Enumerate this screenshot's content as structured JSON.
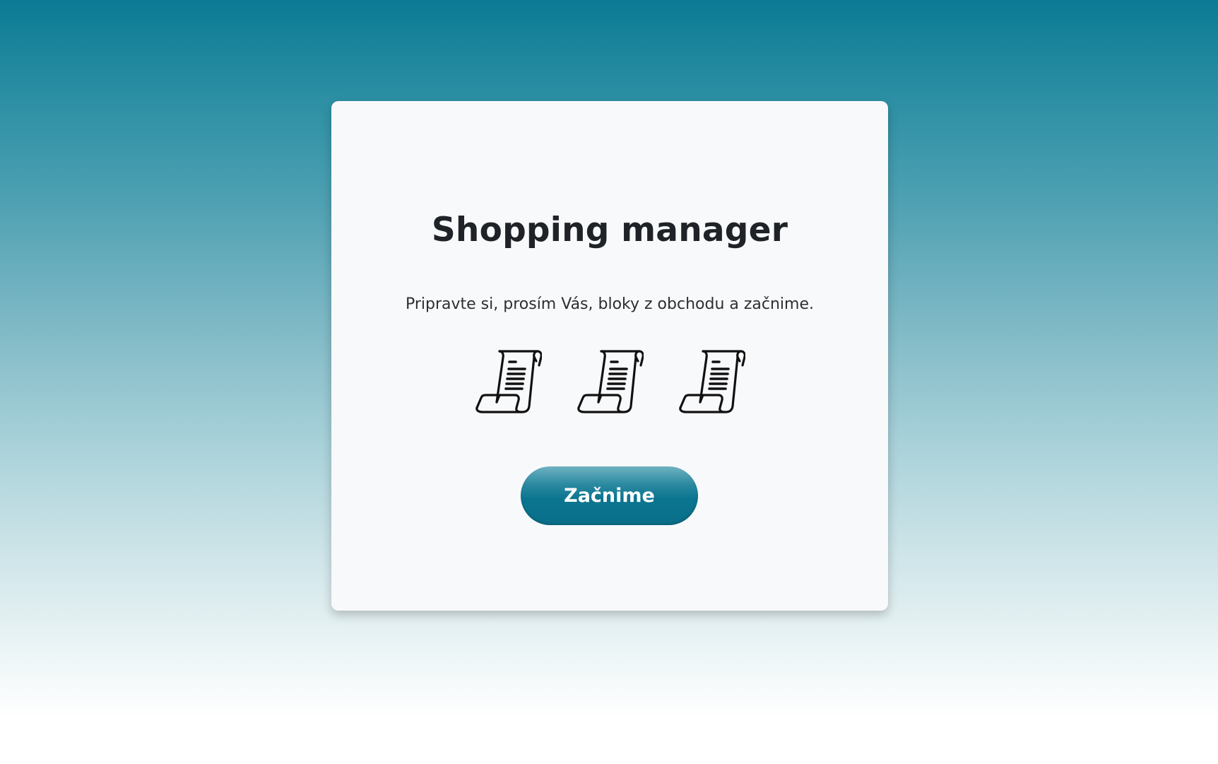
{
  "app": {
    "title": "Shopping manager",
    "subtitle": "Pripravte si, prosím Vás, bloky z obchodu a začnime.",
    "icons": [
      "receipt-scroll-icon",
      "receipt-scroll-icon",
      "receipt-scroll-icon"
    ],
    "start_button_label": "Začnime"
  },
  "colors": {
    "accent": "#0b7590",
    "card_background": "#f8f9fb",
    "text": "#1f2328"
  }
}
